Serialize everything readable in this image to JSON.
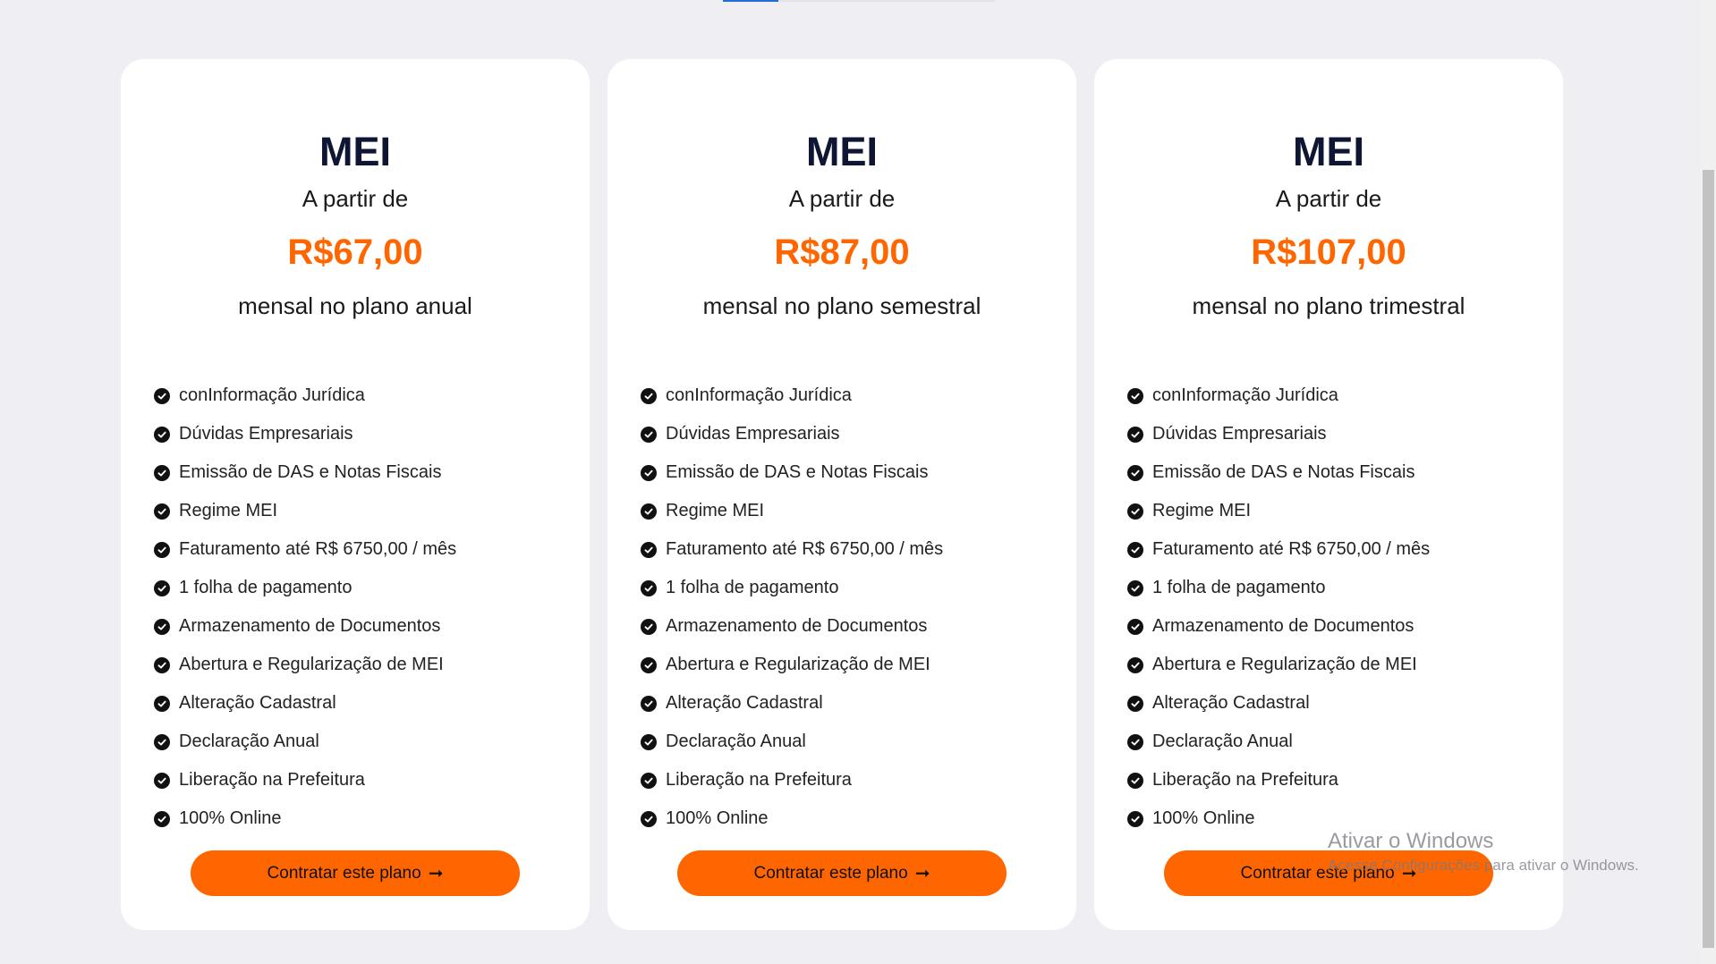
{
  "plans": [
    {
      "name": "MEI",
      "from_text": "A partir de",
      "price": "R$67,00",
      "period": "mensal no plano anual",
      "features": [
        "conInformação Jurídica",
        "Dúvidas Empresariais",
        "Emissão de DAS e Notas Fiscais",
        "Regime MEI",
        "Faturamento até R$ 6750,00 / mês",
        "1 folha de pagamento",
        "Armazenamento de Documentos",
        "Abertura e Regularização de MEI",
        "Alteração Cadastral",
        "Declaração Anual",
        "Liberação na Prefeitura",
        "100% Online"
      ],
      "cta_label": "Contratar este plano",
      "cta_arrow": "➞"
    },
    {
      "name": "MEI",
      "from_text": "A partir de",
      "price": "R$87,00",
      "period": "mensal no plano semestral",
      "features": [
        "conInformação Jurídica",
        "Dúvidas Empresariais",
        "Emissão de DAS e Notas Fiscais",
        "Regime MEI",
        "Faturamento até R$ 6750,00 / mês",
        "1 folha de pagamento",
        "Armazenamento de Documentos",
        "Abertura e Regularização de MEI",
        "Alteração Cadastral",
        "Declaração Anual",
        "Liberação na Prefeitura",
        "100% Online"
      ],
      "cta_label": "Contratar este plano",
      "cta_arrow": "➞"
    },
    {
      "name": "MEI",
      "from_text": "A partir de",
      "price": "R$107,00",
      "period": "mensal no plano trimestral",
      "features": [
        "conInformação Jurídica",
        "Dúvidas Empresariais",
        "Emissão de DAS e Notas Fiscais",
        "Regime MEI",
        "Faturamento até R$ 6750,00 / mês",
        "1 folha de pagamento",
        "Armazenamento de Documentos",
        "Abertura e Regularização de MEI",
        "Alteração Cadastral",
        "Declaração Anual",
        "Liberação na Prefeitura",
        "100% Online"
      ],
      "cta_label": "Contratar este plano",
      "cta_arrow": "➞"
    }
  ],
  "icons": {
    "feature_icon": "check-circle-icon"
  },
  "colors": {
    "background": "#eeeef3",
    "card": "#ffffff",
    "accent": "#ff6600",
    "heading": "#0e1633"
  },
  "watermark": {
    "title": "Ativar o Windows",
    "subtitle": "Acesse Configurações para ativar o Windows."
  }
}
